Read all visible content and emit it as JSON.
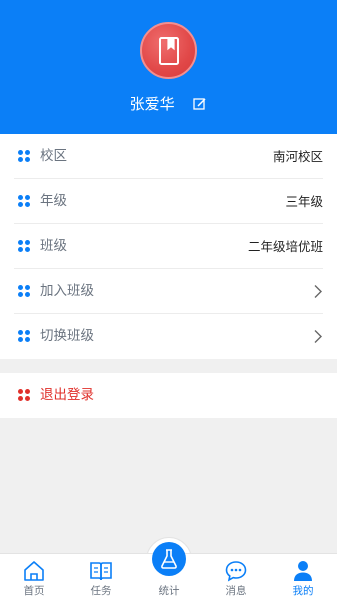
{
  "profile": {
    "name": "张爱华"
  },
  "info_rows": [
    {
      "label": "校区",
      "value": "南河校区"
    },
    {
      "label": "年级",
      "value": "三年级"
    },
    {
      "label": "班级",
      "value": "二年级培优班"
    },
    {
      "label": "加入班级",
      "value": ""
    },
    {
      "label": "切换班级",
      "value": ""
    }
  ],
  "logout": {
    "label": "退出登录"
  },
  "tabs": [
    {
      "label": "首页",
      "icon": "home-icon"
    },
    {
      "label": "任务",
      "icon": "book-icon"
    },
    {
      "label": "统计",
      "icon": "flask-icon"
    },
    {
      "label": "消息",
      "icon": "chat-icon"
    },
    {
      "label": "我的",
      "icon": "person-icon"
    }
  ],
  "colors": {
    "primary": "#0b7ff7",
    "danger": "#e0302b",
    "avatar": "#e14848"
  }
}
